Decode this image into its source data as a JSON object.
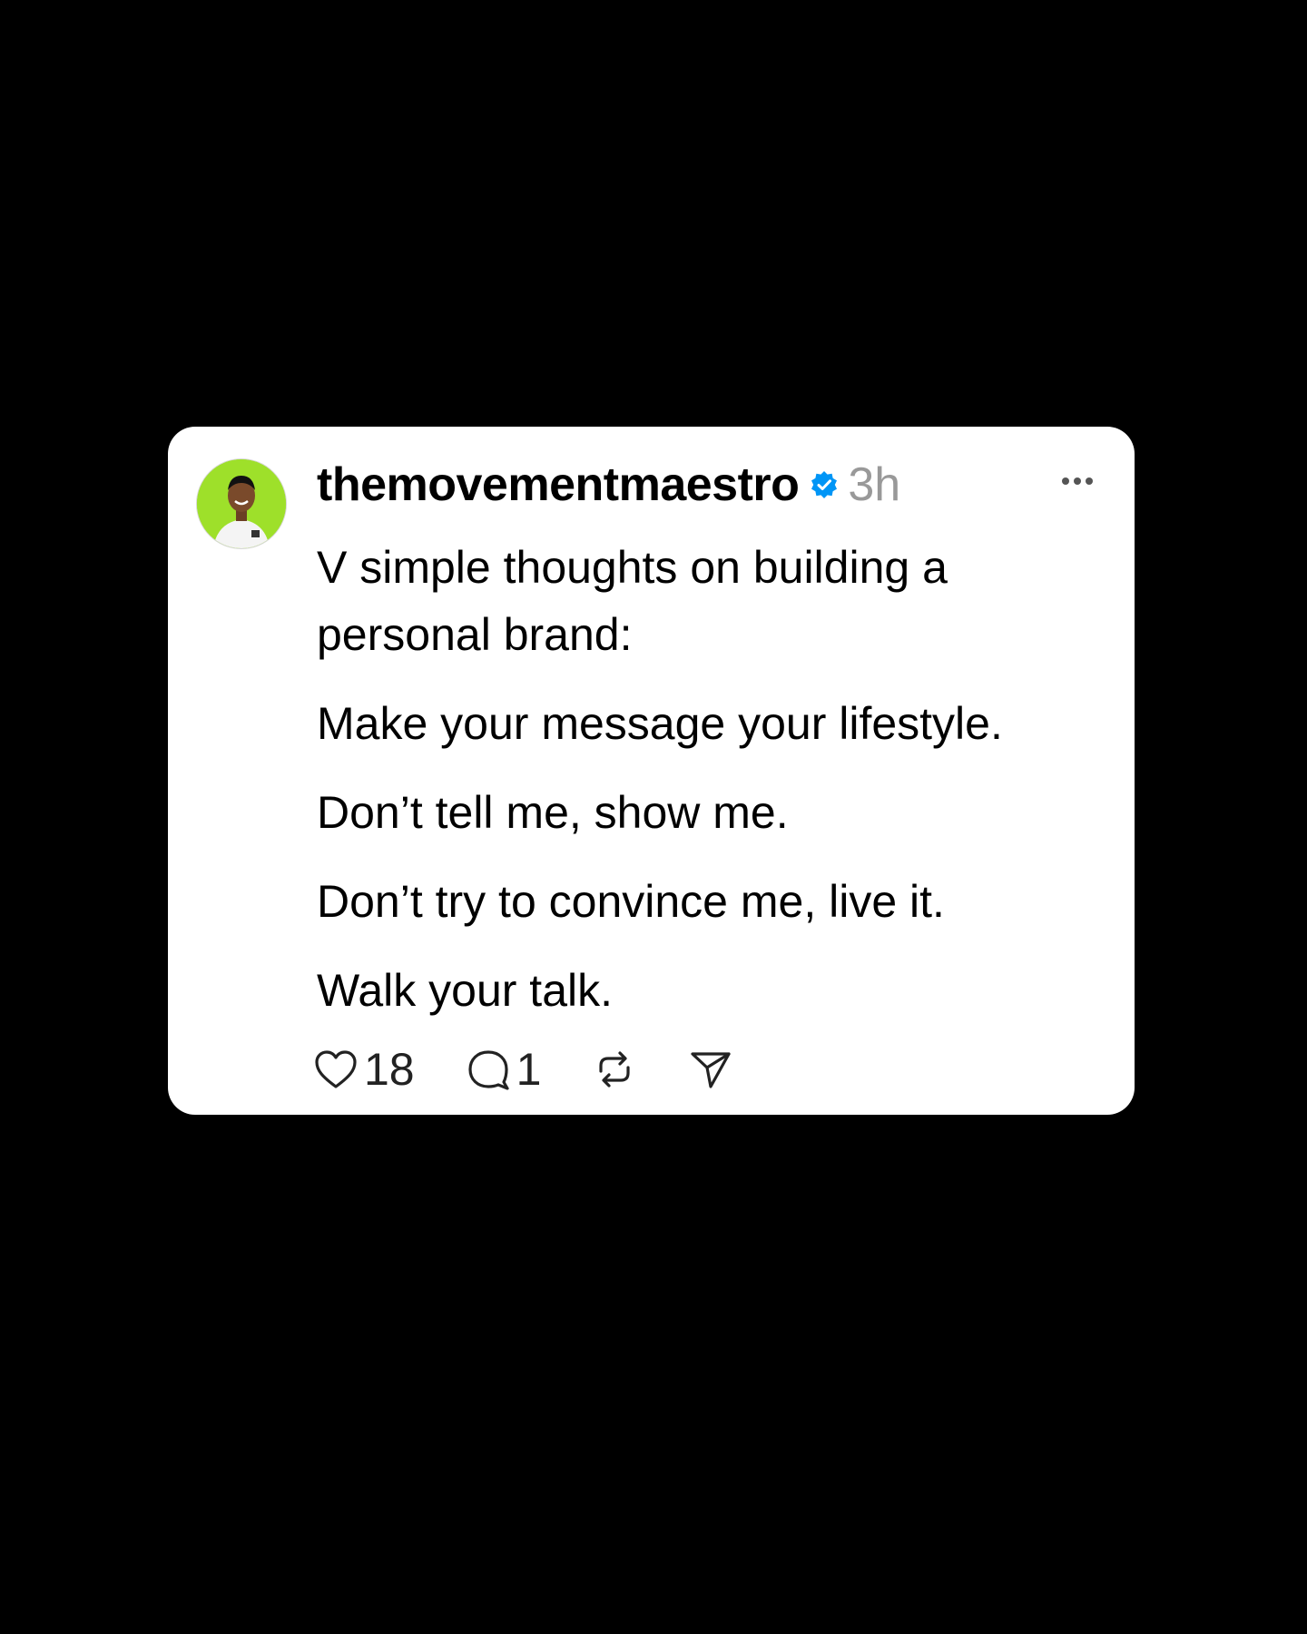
{
  "post": {
    "username": "themovementmaestro",
    "verified": true,
    "timestamp": "3h",
    "body_lines": [
      "V simple thoughts on building a personal brand:",
      "Make your message your lifestyle.",
      "Don’t tell me, show me.",
      "Don’t try to convince me, live it.",
      "Walk your talk."
    ],
    "actions": {
      "likes_count": "18",
      "replies_count": "1"
    }
  },
  "icons": {
    "avatar": "avatar-photo",
    "verified": "verified-badge-icon",
    "more": "more-options-icon",
    "like": "heart-icon",
    "reply": "comment-bubble-icon",
    "repost": "repost-icon",
    "share": "send-icon"
  },
  "colors": {
    "background": "#000000",
    "card": "#ffffff",
    "verified_blue": "#0095f6",
    "timestamp_gray": "#999999",
    "avatar_bg": "#9ee02a"
  }
}
